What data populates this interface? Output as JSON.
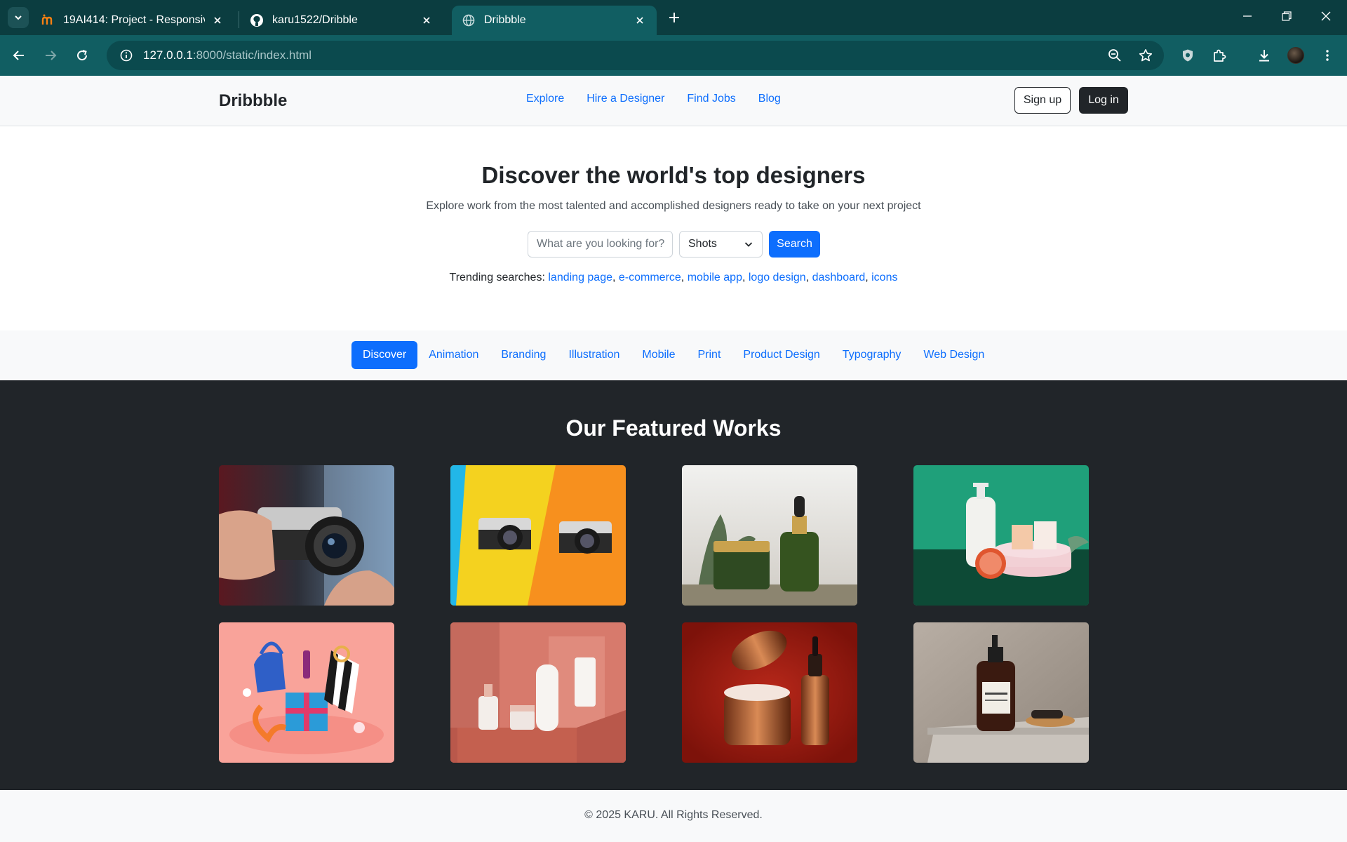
{
  "browser": {
    "tabs": [
      {
        "title": "19AI414: Project - Responsive W",
        "favicon": "moodle-icon",
        "active": false
      },
      {
        "title": "karu1522/Dribble",
        "favicon": "github-icon",
        "active": false
      },
      {
        "title": "Dribbble",
        "favicon": "globe-icon",
        "active": true
      }
    ],
    "url_host": "127.0.0.1",
    "url_path": ":8000/static/index.html"
  },
  "site": {
    "brand": "Dribbble",
    "nav": [
      "Explore",
      "Hire a Designer",
      "Find Jobs",
      "Blog"
    ],
    "signup_label": "Sign up",
    "login_label": "Log in"
  },
  "hero": {
    "title": "Discover the world's top designers",
    "subtitle": "Explore work from the most talented and accomplished designers ready to take on your next project",
    "search_placeholder": "What are you looking for?",
    "select_value": "Shots",
    "search_label": "Search",
    "trending_label": "Trending searches:",
    "trending": [
      "landing page",
      "e-commerce",
      "mobile app",
      "logo design",
      "dashboard",
      "icons"
    ]
  },
  "categories": {
    "active": "Discover",
    "items": [
      "Discover",
      "Animation",
      "Branding",
      "Illustration",
      "Mobile",
      "Print",
      "Product Design",
      "Typography",
      "Web Design"
    ]
  },
  "featured": {
    "title": "Our Featured Works",
    "images": [
      "hand holding Nikon camera",
      "two vintage cameras on yellow and orange",
      "green cosmetic jars with plant",
      "lotion bottle and grapefruit on green",
      "gift boxes and handbag on pink",
      "skincare bottles on salmon podium",
      "copper cream jar and serum on red",
      "shampoo bottle and brush on stone"
    ]
  },
  "footer": {
    "text": "© 2025 KARU. All Rights Reserved."
  },
  "colors": {
    "primary": "#0d6efd",
    "dark": "#212529",
    "chrome": "#115e62"
  }
}
